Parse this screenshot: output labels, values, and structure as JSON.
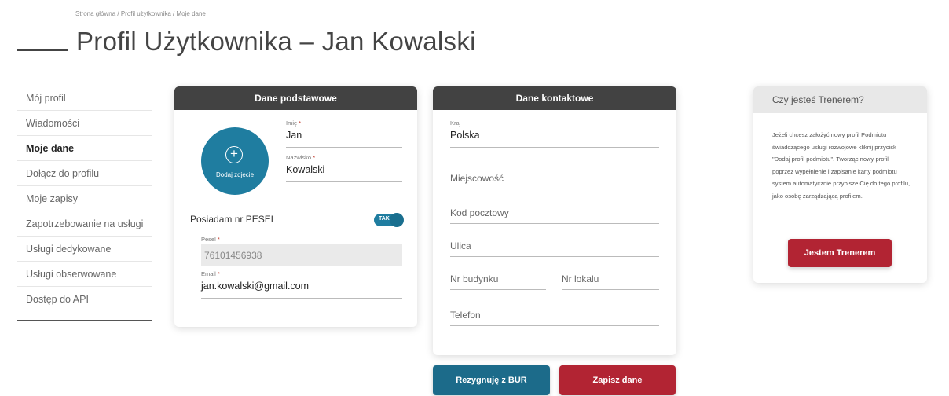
{
  "breadcrumb": "Strona główna / Profil użytkownika / Moje dane",
  "page_title": "Profil Użytkownika – Jan Kowalski",
  "sidebar": {
    "items": [
      {
        "label": "Mój profil"
      },
      {
        "label": "Wiadomości"
      },
      {
        "label": "Moje dane",
        "active": true
      },
      {
        "label": "Dołącz do profilu"
      },
      {
        "label": "Moje zapisy"
      },
      {
        "label": "Zapotrzebowanie na usługi"
      },
      {
        "label": "Usługi dedykowane"
      },
      {
        "label": "Usługi obserwowane"
      },
      {
        "label": "Dostęp do API"
      }
    ]
  },
  "basic": {
    "header": "Dane podstawowe",
    "add_photo": "Dodaj zdjęcie",
    "first_name_label": "Imię",
    "first_name": "Jan",
    "last_name_label": "Nazwisko",
    "last_name": "Kowalski",
    "pesel_toggle_label": "Posiadam nr PESEL",
    "toggle_text": "TAK",
    "pesel_label": "Pesel",
    "pesel": "76101456938",
    "email_label": "Email",
    "email": "jan.kowalski@gmail.com",
    "required_mark": "*"
  },
  "contact": {
    "header": "Dane kontaktowe",
    "country_label": "Kraj",
    "country": "Polska",
    "city_placeholder": "Miejscowość",
    "postal_placeholder": "Kod pocztowy",
    "street_placeholder": "Ulica",
    "building_placeholder": "Nr budynku",
    "apartment_placeholder": "Nr lokalu",
    "phone_placeholder": "Telefon"
  },
  "actions": {
    "resign": "Rezygnuję z BUR",
    "save": "Zapisz dane"
  },
  "trainer": {
    "header": "Czy jesteś Trenerem?",
    "text": "Jeżeli chcesz założyć nowy profil Podmiotu świadczącego usługi rozwojowe kliknij przycisk \"Dodaj profil podmiotu\". Tworząc nowy profil poprzez wypełnienie i zapisanie karty podmiotu system automatycznie przypisze Cię do tego profilu, jako osobę zarządzającą profilem.",
    "button": "Jestem Trenerem"
  },
  "colors": {
    "header_dark": "#424242",
    "accent_blue": "#1f7da0",
    "accent_red": "#b22433"
  }
}
